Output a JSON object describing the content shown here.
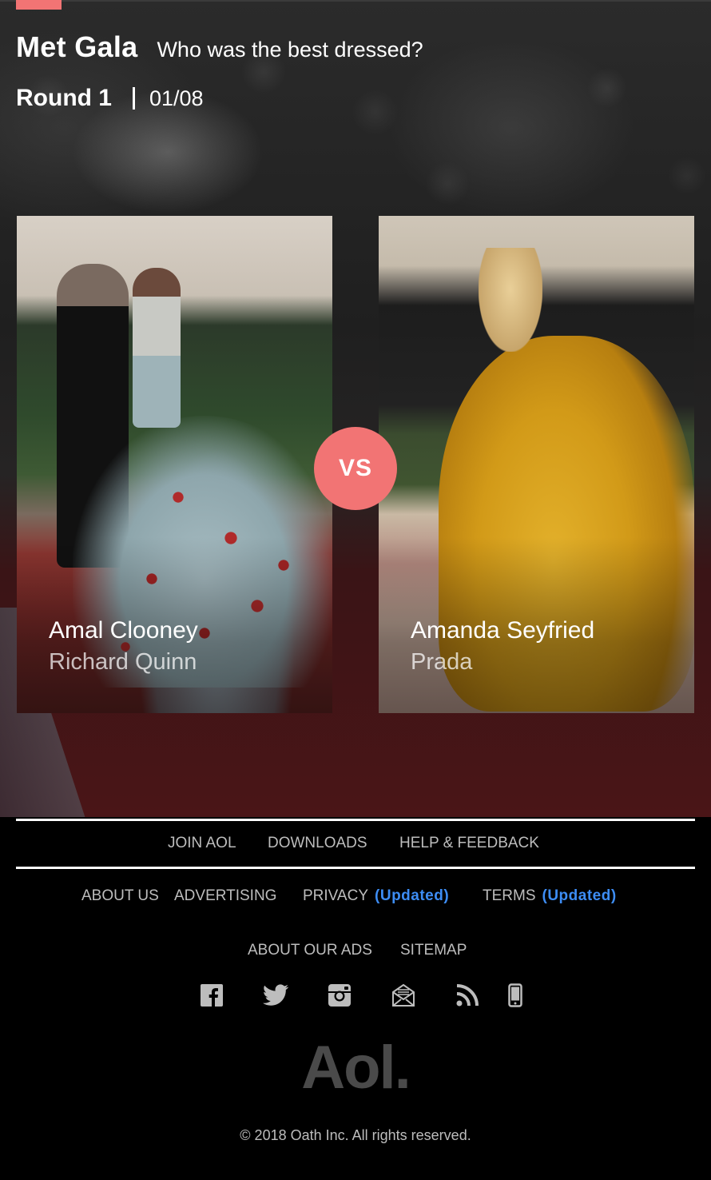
{
  "header": {
    "title": "Met Gala",
    "question": "Who was the best dressed?",
    "round_label": "Round 1",
    "round_progress": "01/08"
  },
  "matchup": {
    "left": {
      "name": "Amal Clooney",
      "designer": "Richard Quinn"
    },
    "right": {
      "name": "Amanda Seyfried",
      "designer": "Prada"
    },
    "vs_label": "VS"
  },
  "footer": {
    "primary_links": [
      "JOIN AOL",
      "DOWNLOADS",
      "HELP & FEEDBACK"
    ],
    "secondary_links": {
      "about": "ABOUT US",
      "advertising": "ADVERTISING",
      "privacy": "PRIVACY",
      "privacy_note": "(Updated)",
      "terms": "TERMS",
      "terms_note": "(Updated)"
    },
    "tertiary_links": [
      "ABOUT OUR ADS",
      "SITEMAP"
    ],
    "social_icons": [
      "facebook-icon",
      "twitter-icon",
      "instagram-icon",
      "newsletter-icon",
      "rss-icon",
      "mobile-icon"
    ],
    "logo_text": "Aol.",
    "copyright": "© 2018  Oath Inc. All rights reserved."
  },
  "colors": {
    "accent": "#f27474",
    "updated_link": "#3d8df5",
    "footer_text": "#bdbdbd",
    "logo": "#4a4a4a"
  }
}
